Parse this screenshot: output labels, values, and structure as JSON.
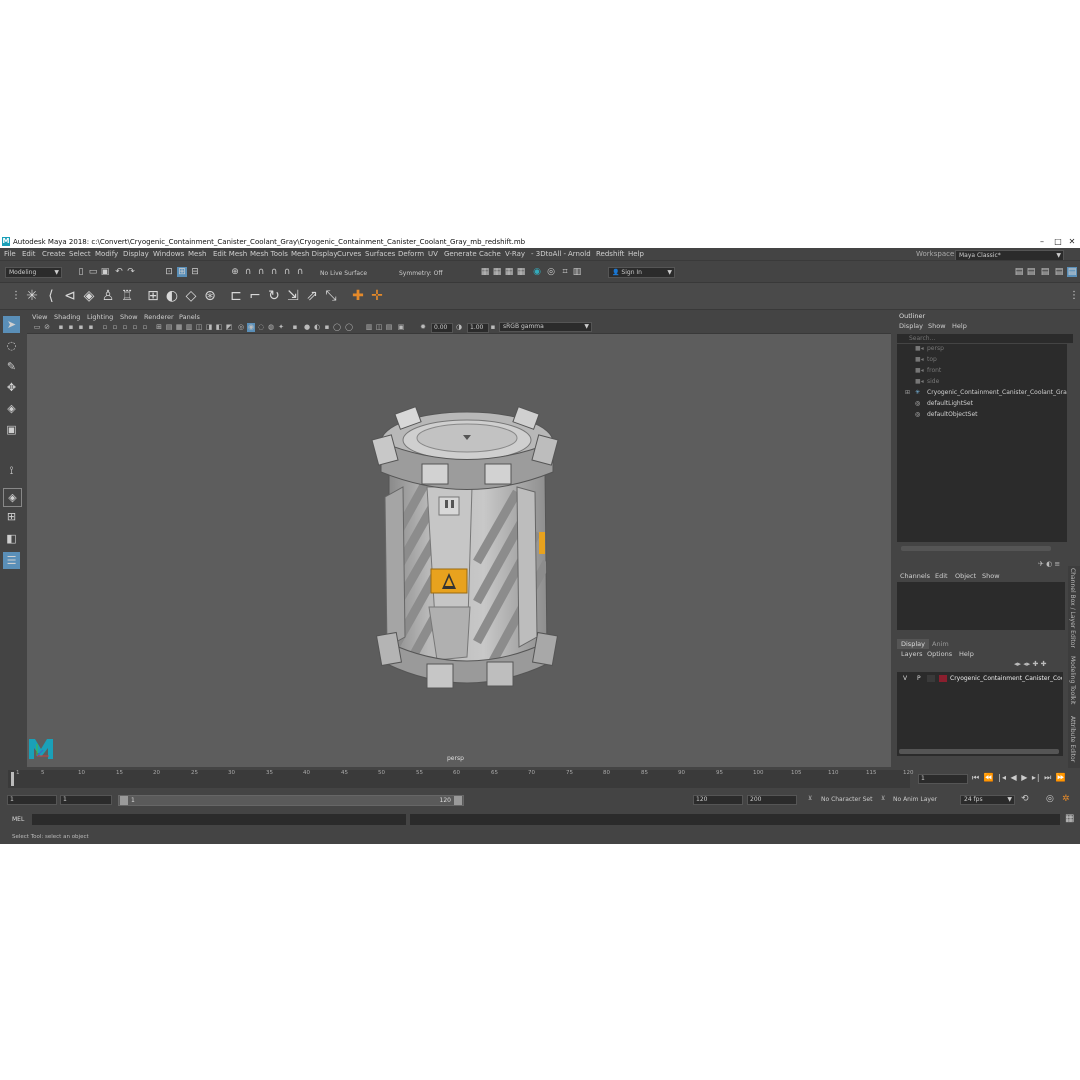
{
  "window": {
    "title": "Autodesk Maya 2018: c:\\Convert\\Cryogenic_Containment_Canister_Coolant_Gray\\Cryogenic_Containment_Canister_Coolant_Gray_mb_redshift.mb",
    "logo": "M"
  },
  "menubar": {
    "items": [
      "File",
      "Edit",
      "Create",
      "Select",
      "Modify",
      "Display",
      "Windows",
      "Mesh",
      "Edit Mesh",
      "Mesh Tools",
      "Mesh Display",
      "Curves",
      "Surfaces",
      "Deform",
      "UV",
      "Generate",
      "Cache",
      "V-Ray",
      "- 3DtoAll -",
      "Arnold",
      "Redshift",
      "Help"
    ],
    "workspace_label": "Workspace :",
    "workspace_value": "Maya Classic*"
  },
  "statusline": {
    "mode": "Modeling",
    "live_surface": "No Live Surface",
    "symmetry": "Symmetry: Off",
    "sign_in": "Sign In"
  },
  "viewport": {
    "menu": [
      "View",
      "Shading",
      "Lighting",
      "Show",
      "Renderer",
      "Panels"
    ],
    "exposure": "0.00",
    "gamma": "1.00",
    "color_space": "sRGB gamma",
    "camera_label": "persp"
  },
  "outliner": {
    "title": "Outliner",
    "menu": [
      "Display",
      "Show",
      "Help"
    ],
    "search_placeholder": "Search...",
    "items": [
      {
        "label": "persp",
        "dim": true
      },
      {
        "label": "top",
        "dim": true
      },
      {
        "label": "front",
        "dim": true
      },
      {
        "label": "side",
        "dim": true
      },
      {
        "label": "Cryogenic_Containment_Canister_Coolant_Gray_m",
        "dim": false
      },
      {
        "label": "defaultLightSet",
        "dim": false
      },
      {
        "label": "defaultObjectSet",
        "dim": false
      }
    ]
  },
  "channelbox": {
    "menu": [
      "Channels",
      "Edit",
      "Object",
      "Show"
    ]
  },
  "layers": {
    "tabs": [
      "Display",
      "Anim"
    ],
    "menu": [
      "Layers",
      "Options",
      "Help"
    ],
    "row": {
      "v": "V",
      "p": "P",
      "name": "Cryogenic_Containment_Canister_Coolant",
      "color": "#8a1f2e"
    }
  },
  "sidetabs": [
    "Channel Box / Layer Editor",
    "Modeling Toolkit",
    "Attribute Editor"
  ],
  "timeline": {
    "ticks": [
      "5",
      "10",
      "15",
      "20",
      "25",
      "30",
      "35",
      "40",
      "45",
      "50",
      "55",
      "60",
      "65",
      "70",
      "75",
      "80",
      "85",
      "90",
      "95",
      "100",
      "105",
      "110",
      "115",
      "120"
    ],
    "start_tick": "1",
    "current_frame": "1"
  },
  "range": {
    "start": "1",
    "playback_start": "1",
    "slider_start": "1",
    "slider_end": "120",
    "playback_end": "120",
    "end": "200",
    "character_set": "No Character Set",
    "anim_layer": "No Anim Layer",
    "fps": "24 fps"
  },
  "command": {
    "mel_label": "MEL"
  },
  "help": {
    "text": "Select Tool: select an object"
  },
  "colors": {
    "accent": "#5a8fb8",
    "warning_label": "#e8a21e"
  }
}
